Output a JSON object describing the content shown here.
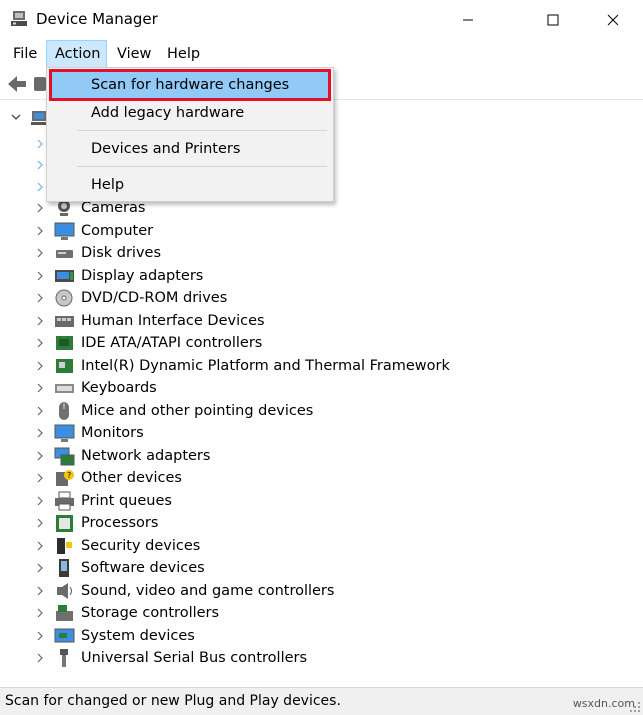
{
  "window": {
    "title": "Device Manager",
    "minimize_glyph": "—",
    "maximize_glyph": "☐",
    "close_glyph": "✕"
  },
  "menu": [
    "File",
    "Action",
    "View",
    "Help"
  ],
  "action_menu": {
    "items": [
      "Scan for hardware changes",
      "Add legacy hardware",
      "Devices and Printers",
      "Help"
    ],
    "highlighted": "Scan for hardware changes"
  },
  "tree": {
    "categories": [
      {
        "label": "Cameras",
        "icon": "camera-icon"
      },
      {
        "label": "Computer",
        "icon": "computer-icon"
      },
      {
        "label": "Disk drives",
        "icon": "disk-drive-icon"
      },
      {
        "label": "Display adapters",
        "icon": "display-adapter-icon"
      },
      {
        "label": "DVD/CD-ROM drives",
        "icon": "dvd-drive-icon"
      },
      {
        "label": "Human Interface Devices",
        "icon": "hid-icon"
      },
      {
        "label": "IDE ATA/ATAPI controllers",
        "icon": "ide-controller-icon"
      },
      {
        "label": "Intel(R) Dynamic Platform and Thermal Framework",
        "icon": "thermal-framework-icon"
      },
      {
        "label": "Keyboards",
        "icon": "keyboard-icon"
      },
      {
        "label": "Mice and other pointing devices",
        "icon": "mouse-icon"
      },
      {
        "label": "Monitors",
        "icon": "monitor-icon"
      },
      {
        "label": "Network adapters",
        "icon": "network-adapter-icon"
      },
      {
        "label": "Other devices",
        "icon": "other-devices-icon"
      },
      {
        "label": "Print queues",
        "icon": "printer-icon"
      },
      {
        "label": "Processors",
        "icon": "processor-icon"
      },
      {
        "label": "Security devices",
        "icon": "security-device-icon"
      },
      {
        "label": "Software devices",
        "icon": "software-device-icon"
      },
      {
        "label": "Sound, video and game controllers",
        "icon": "sound-icon"
      },
      {
        "label": "Storage controllers",
        "icon": "storage-controller-icon"
      },
      {
        "label": "System devices",
        "icon": "system-devices-icon"
      },
      {
        "label": "Universal Serial Bus controllers",
        "icon": "usb-icon"
      }
    ]
  },
  "status": {
    "text": "Scan for changed or new Plug and Play devices.",
    "watermark": "wsxdn.com"
  },
  "colors": {
    "menu_active_bg": "#cce8ff",
    "dropdown_highlight": "#91c9f7",
    "callout_red": "#e0112b",
    "icon_blue": "#2b7fd4"
  }
}
